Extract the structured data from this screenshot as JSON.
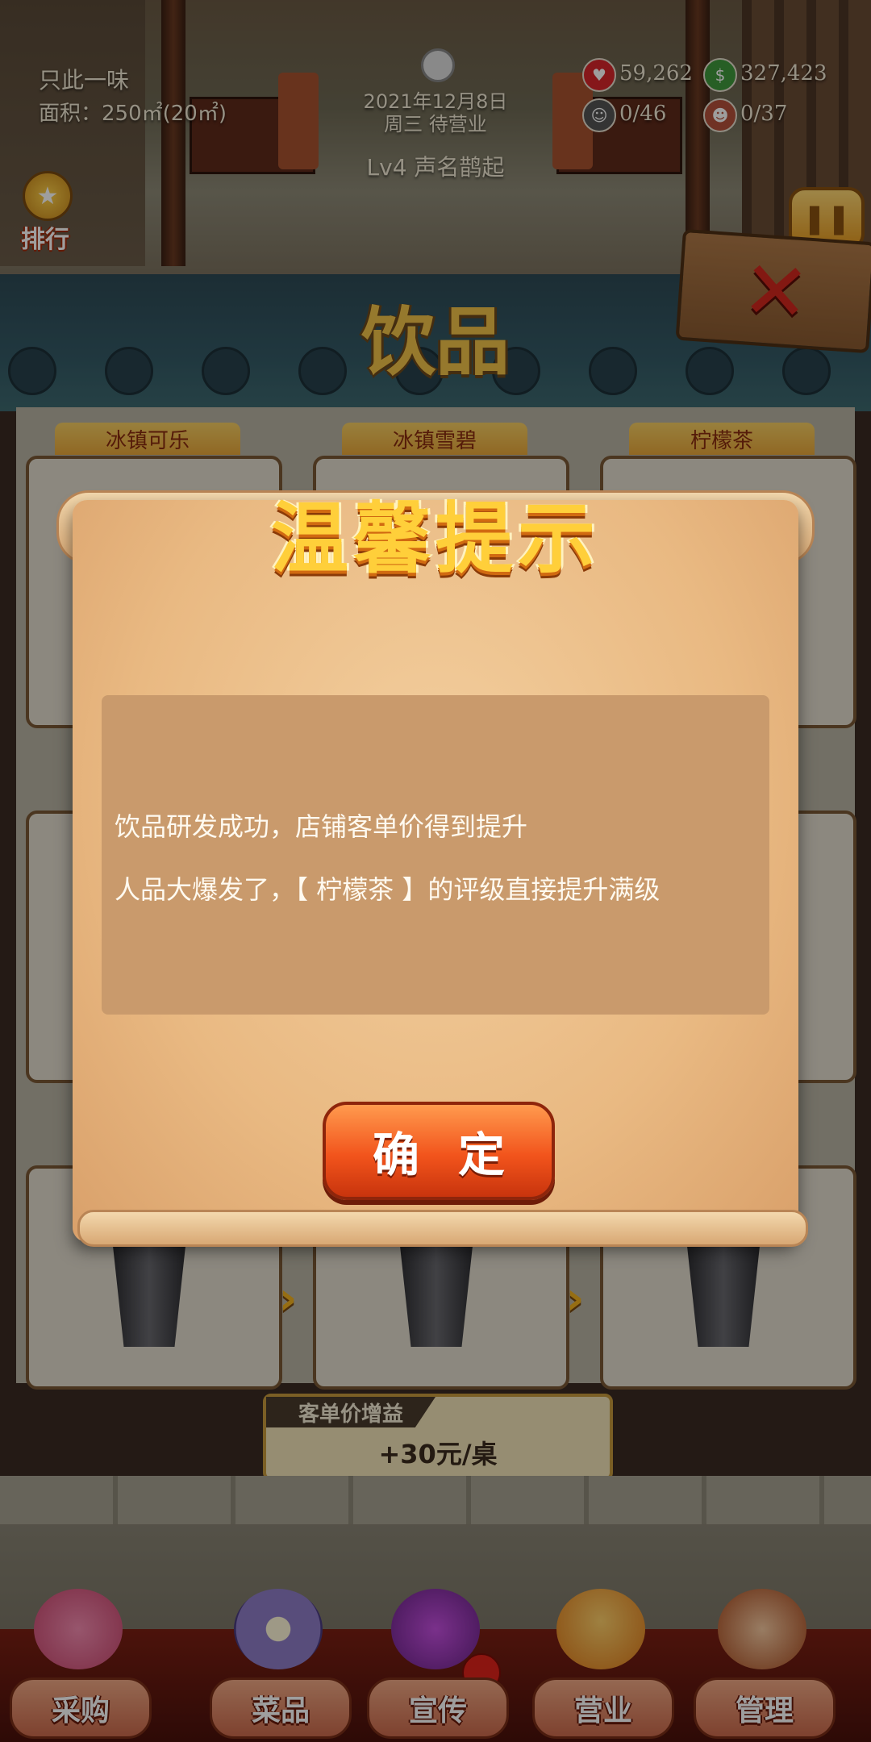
{
  "hud": {
    "shop_name": "只此一味",
    "area": "面积：250㎡(20㎡)",
    "date": "2021年12月8日",
    "status": "周三 待营业",
    "level": "Lv4 声名鹊起",
    "hearts": "59,262",
    "cash": "327,423",
    "chefs": "0/46",
    "staff": "0/37",
    "rank_label": "排行"
  },
  "section_title": "饮品",
  "drinks": [
    "冰镇可乐",
    "冰镇雪碧",
    "柠檬茶"
  ],
  "dialog": {
    "title": "温馨提示",
    "line1": "饮品研发成功，店铺客单价得到提升",
    "line2": "人品大爆发了，【 柠檬茶 】的评级直接提升满级",
    "confirm": "确定"
  },
  "bonus": {
    "label": "客单价增益",
    "value": "+30元/桌"
  },
  "nav": [
    "采购",
    "菜品",
    "宣传",
    "营业",
    "管理"
  ],
  "colors": {
    "accent_orange": "#f2541c",
    "title_gold": "#ffcf3a",
    "scroll": "#e9b982"
  }
}
